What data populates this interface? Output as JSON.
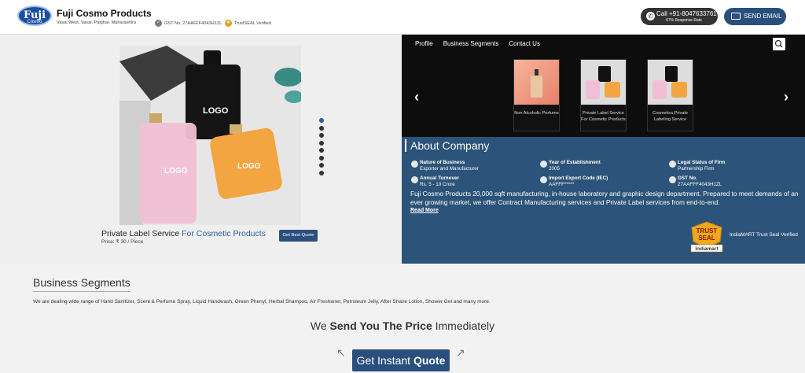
{
  "header": {
    "logo_text": "Fuji",
    "logo_sub": "Cosmo",
    "company_name": "Fuji Cosmo Products",
    "address": "Vasai West, Vasai, Palghar, Maharashtra",
    "gst": "GST No. 27AAFFF4043H1ZL",
    "trustseal": "TrustSEAL Verified",
    "call_label": "Call +91-8047633761",
    "call_sub": "67% Response Rate",
    "email_label": "SEND EMAIL"
  },
  "nav": {
    "items": [
      "Profile",
      "Business Segments",
      "Contact Us"
    ]
  },
  "product": {
    "title_main": "Private Label Service ",
    "title_accent": "For Cosmetic Products",
    "price": "Price: ₹ 30 / Piece",
    "quote_button": "Get Best Quote",
    "logo_black": "LOGO",
    "logo_pink": "LOGO",
    "logo_orange": "LOGO"
  },
  "carousel": {
    "cards": [
      {
        "label": "Non Alcoholic Perfume"
      },
      {
        "label": "Private Label Service For Cosmetic Products"
      },
      {
        "label": "Cosmetics Private Labeling Service"
      }
    ]
  },
  "about": {
    "heading": "About Company",
    "facts": [
      {
        "label": "Nature of Business",
        "value": "Exporter and Manufacturer"
      },
      {
        "label": "Year of Establishment",
        "value": "2005"
      },
      {
        "label": "Legal Status of Firm",
        "value": "Partnership Firm"
      },
      {
        "label": "Annual Turnover",
        "value": "Rs. 5 - 10 Crore"
      },
      {
        "label": "Import Export Code (IEC)",
        "value": "AAFFF*****"
      },
      {
        "label": "GST No.",
        "value": "27AAFFF4043H1ZL"
      }
    ],
    "description": "Fuji Cosmo Products 20,000 sqft manufacturing, in-house laboratory and graphic design department. Prepared to meet demands of an ever growing market, we offer Contract Manufacturing services and Private Label services from end-to-end.",
    "read_more": "Read More",
    "seal_top": "TRUST",
    "seal_mid": "SEAL",
    "seal_bottom": "indiamart",
    "seal_text": "IndiaMART Trust Seal Verified"
  },
  "business": {
    "heading": "Business Segments",
    "text": "We are dealing wide range of Hand Sanitizer, Scent & Perfume Spray, Liquid Handwash, Green Phenyl, Herbal Shampoo, Air Freshener, Petroleum Jelly, After Shave Lotion, Shower Gel and many more."
  },
  "cta": {
    "send_pre": "We ",
    "send_bold": "Send You The Price",
    "send_post": " Immediately",
    "button_pre": "Get Instant ",
    "button_bold": "Quote"
  },
  "colors": {
    "brand_blue": "#2a4f7c",
    "about_bg": "#2c5379",
    "nav_bg": "#0d0d0d"
  }
}
